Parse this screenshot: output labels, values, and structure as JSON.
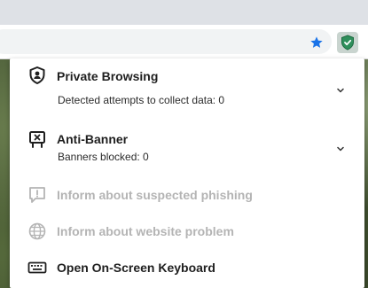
{
  "popup": {
    "private_browsing": {
      "title": "Private Browsing",
      "subtitle": "Detected attempts to collect data: 0"
    },
    "anti_banner": {
      "title": "Anti-Banner",
      "subtitle": "Banners blocked: 0"
    },
    "phishing": {
      "label": "Inform about suspected phishing"
    },
    "website_problem": {
      "label": "Inform about website problem"
    },
    "keyboard": {
      "label": "Open On-Screen Keyboard"
    }
  },
  "colors": {
    "accent_star": "#1a73e8",
    "extension_icon": "#2f8f5b",
    "disabled_text": "#b4b4b4"
  }
}
